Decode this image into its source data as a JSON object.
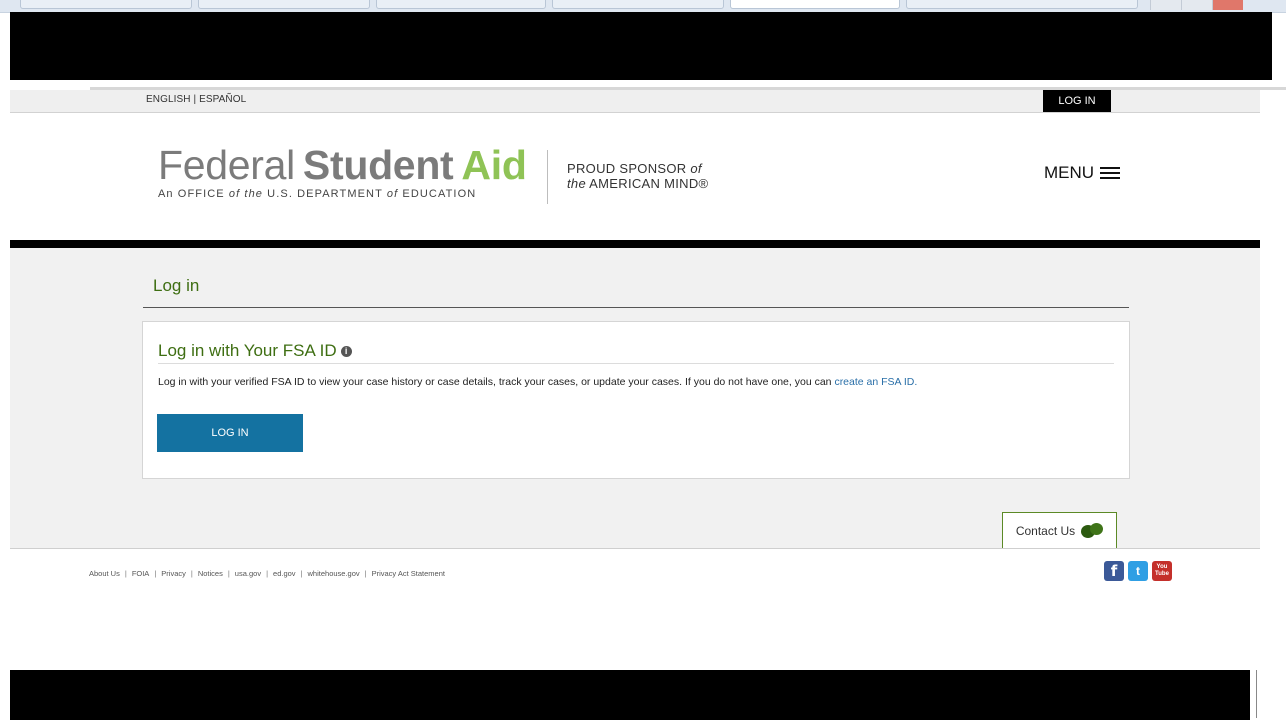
{
  "utility": {
    "lang_english": "ENGLISH",
    "lang_separator": " | ",
    "lang_espanol": "ESPAÑOL",
    "login_label": "LOG IN"
  },
  "header": {
    "logo_federal": "Federal",
    "logo_student": "Student",
    "logo_aid": "Aid",
    "logo_sub_an": "An OFFICE ",
    "logo_sub_of1": "of the",
    "logo_sub_dept": " U.S. DEPARTMENT ",
    "logo_sub_of2": "of",
    "logo_sub_edu": " EDUCATION",
    "sponsor_line1": "PROUD SPONSOR ",
    "sponsor_of": "of",
    "sponsor_the": "the",
    "sponsor_line2": " AMERICAN MIND®",
    "menu_label": "MENU",
    "colors": {
      "aid_green": "#8fc356",
      "logo_gray": "#7b7b7b"
    }
  },
  "main": {
    "page_title": "Log in",
    "card": {
      "title": "Log in with Your FSA ID",
      "info_icon": "info-icon",
      "text": "Log in with your verified FSA ID to view your case history or case details, track your cases, or update your cases. If you do not have one, you can ",
      "link_text": "create an FSA ID.",
      "button_label": "LOG IN",
      "button_color": "#1472a1"
    },
    "contact_label": "Contact Us",
    "contact_icon": "chat-bubbles-icon"
  },
  "footer": {
    "links": [
      "About Us",
      "FOIA",
      "Privacy",
      "Notices",
      "usa.gov",
      "ed.gov",
      "whitehouse.gov",
      "Privacy Act Statement"
    ],
    "separator": "|",
    "social": {
      "facebook": "f",
      "twitter": "t",
      "youtube_top": "You",
      "youtube_bottom": "Tube"
    }
  }
}
